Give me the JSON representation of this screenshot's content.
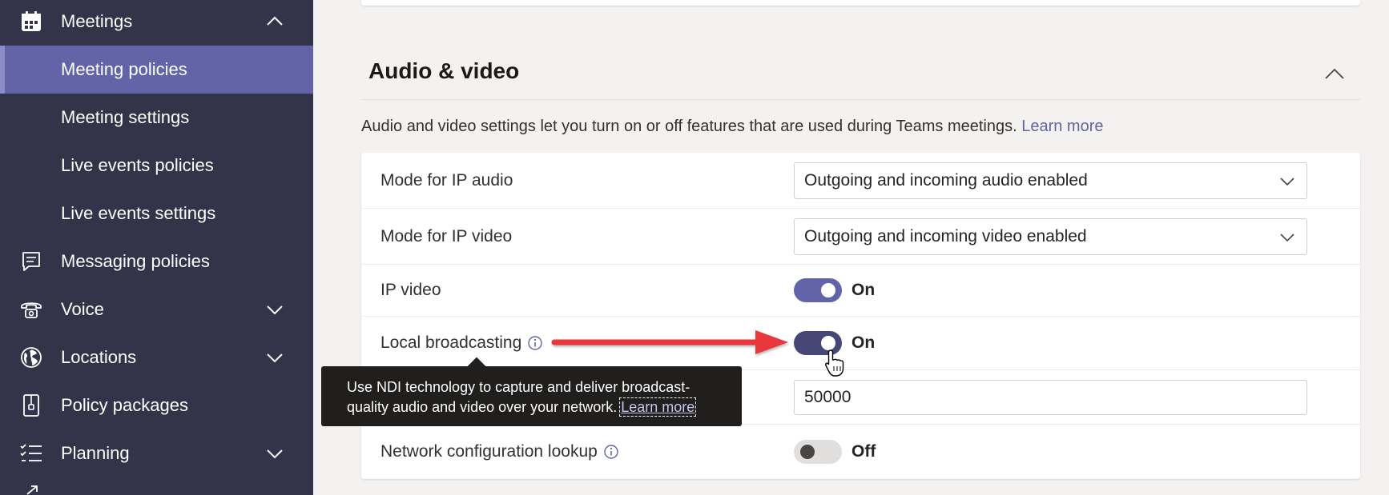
{
  "sidebar": {
    "items": [
      {
        "label": "Meetings",
        "icon": "calendar-icon",
        "expanded": true
      },
      {
        "label": "Meeting policies",
        "active": true
      },
      {
        "label": "Meeting settings"
      },
      {
        "label": "Live events policies"
      },
      {
        "label": "Live events settings"
      },
      {
        "label": "Messaging policies",
        "icon": "message-icon"
      },
      {
        "label": "Voice",
        "icon": "phone-icon",
        "expanded": false
      },
      {
        "label": "Locations",
        "icon": "globe-icon",
        "expanded": false
      },
      {
        "label": "Policy packages",
        "icon": "package-icon"
      },
      {
        "label": "Planning",
        "icon": "checklist-icon",
        "expanded": false
      }
    ]
  },
  "section": {
    "title": "Audio & video",
    "description": "Audio and video settings let you turn on or off features that are used during Teams meetings.",
    "learn_more": "Learn more"
  },
  "settings": {
    "ip_audio": {
      "label": "Mode for IP audio",
      "value": "Outgoing and incoming audio enabled"
    },
    "ip_video_mode": {
      "label": "Mode for IP video",
      "value": "Outgoing and incoming video enabled"
    },
    "ip_video": {
      "label": "IP video",
      "state": "On"
    },
    "local_broadcasting": {
      "label": "Local broadcasting",
      "state": "On"
    },
    "hidden_row": {
      "value": "50000"
    },
    "network_lookup": {
      "label": "Network configuration lookup",
      "state": "Off"
    }
  },
  "tooltip": {
    "line1": "Use NDI technology to capture and deliver broadcast-",
    "line2": "quality audio and video over your network.",
    "link": "Learn more"
  },
  "colors": {
    "sidebar_bg": "#33344a",
    "accent": "#6264a7",
    "arrow": "#e8383d"
  }
}
